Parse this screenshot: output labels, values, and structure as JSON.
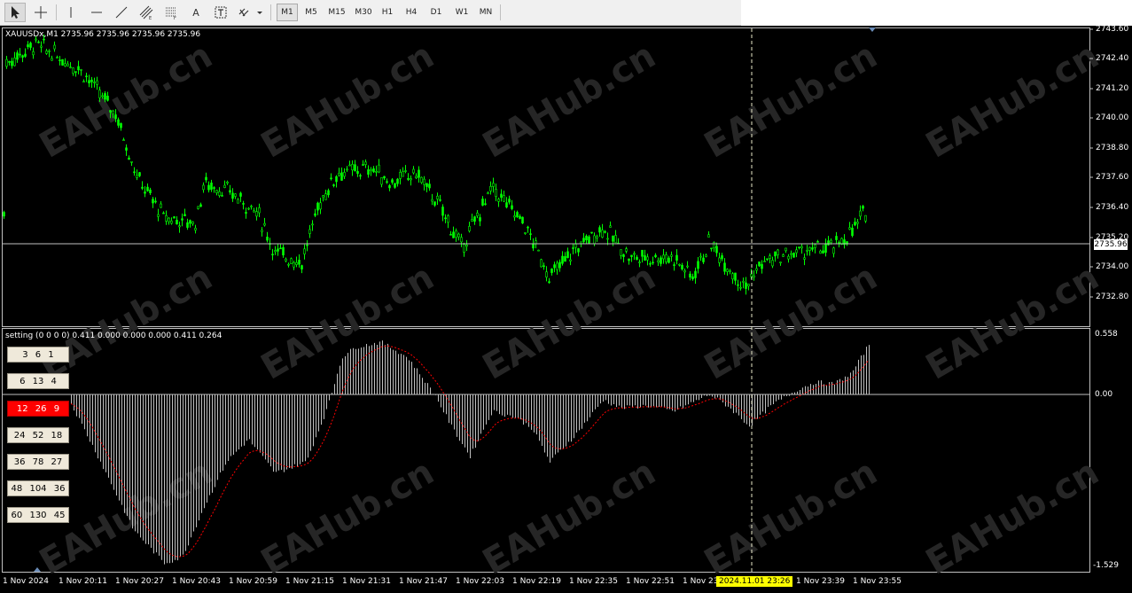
{
  "toolbar": {
    "tools": [
      {
        "name": "cursor-tool",
        "icon": "arrow-cursor-icon",
        "active": true
      },
      {
        "name": "crosshair-tool",
        "icon": "crosshair-icon"
      },
      {
        "name": "vertical-line-tool",
        "icon": "vertical-line-icon"
      },
      {
        "name": "horizontal-line-tool",
        "icon": "horizontal-line-icon"
      },
      {
        "name": "trendline-tool",
        "icon": "trendline-icon"
      },
      {
        "name": "equidistant-channel-tool",
        "icon": "channel-icon"
      },
      {
        "name": "fibonacci-tool",
        "icon": "fibonacci-icon"
      },
      {
        "name": "text-tool",
        "icon": "text-icon",
        "glyph": "A"
      },
      {
        "name": "text-label-tool",
        "icon": "text-label-icon"
      },
      {
        "name": "shapes-menu-tool",
        "icon": "shapes-dropdown-icon"
      }
    ],
    "timeframes": [
      "M1",
      "M5",
      "M15",
      "M30",
      "H1",
      "H4",
      "D1",
      "W1",
      "MN"
    ],
    "active_timeframe": "M1"
  },
  "main_chart": {
    "header": "XAUUSDx,M1  2735.96 2735.96 2735.96 2735.96",
    "current_price": "2735.96",
    "price_scale": [
      "2743.60",
      "2742.40",
      "2741.20",
      "2740.00",
      "2738.80",
      "2737.60",
      "2736.40",
      "2735.20",
      "2734.00",
      "2732.80"
    ],
    "candle_color": "#00ff00"
  },
  "indicator": {
    "header": "setting (0 0 0 0) 0.411 0.000 0.000 0.000 0.411 0.264",
    "scale": [
      "0.558",
      "0.00",
      "-1.529"
    ],
    "presets": [
      "3  6  1",
      "6  13  4",
      "12  26  9",
      "24  52  18",
      "36  78  27",
      "48  104  36",
      "60  130  45"
    ],
    "active_preset": "12  26  9",
    "histogram_color": "#c0c0c0",
    "signal_color": "#ff0000"
  },
  "time_axis": [
    "1 Nov 2024",
    "1 Nov 20:11",
    "1 Nov 20:27",
    "1 Nov 20:43",
    "1 Nov 20:59",
    "1 Nov 21:15",
    "1 Nov 21:31",
    "1 Nov 21:47",
    "1 Nov 22:03",
    "1 Nov 22:19",
    "1 Nov 22:35",
    "1 Nov 22:51",
    "1 Nov 23",
    "1 Nov 23:39",
    "1 Nov 23:55"
  ],
  "crosshair_time": "2024.11.01 23:26",
  "watermark": "EAHub.cn"
}
